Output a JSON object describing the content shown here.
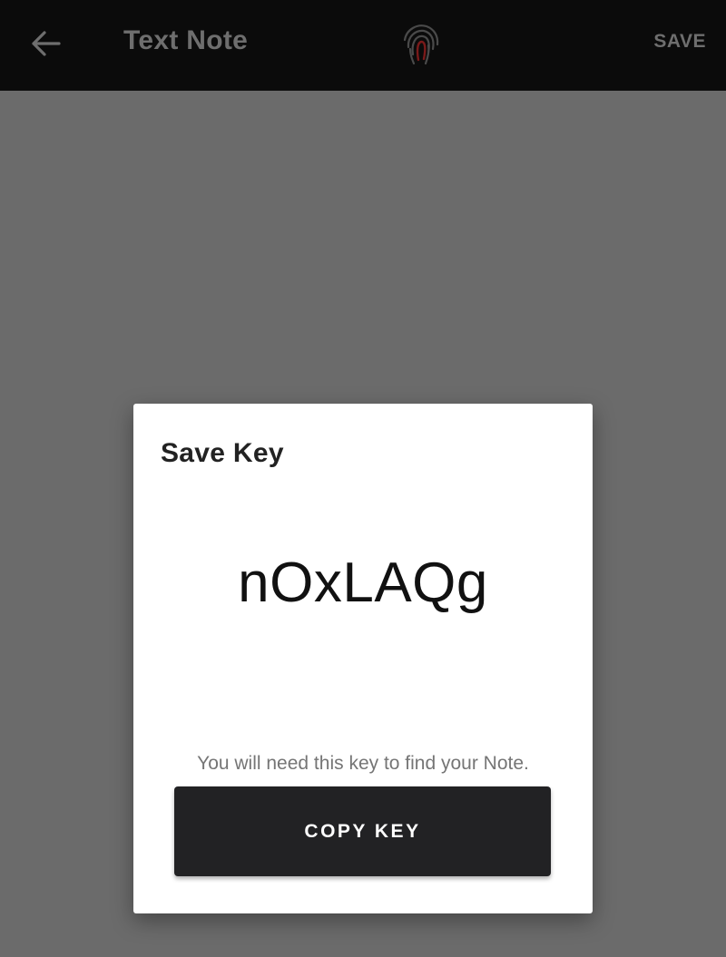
{
  "appbar": {
    "back_icon": "arrow-left-icon",
    "title": "Text Note",
    "logo_icon": "fingerprint-icon",
    "save_label": "SAVE"
  },
  "dialog": {
    "title": "Save Key",
    "key": "nOxLAQg",
    "hint": "You will need this key to find your Note.",
    "copy_label": "COPY KEY"
  },
  "colors": {
    "appbar_bg": "#0b0b0b",
    "scrim": "#6b6b6b",
    "dialog_bg": "#ffffff",
    "button_bg": "#222224",
    "logo_accent": "#7a1a1a"
  }
}
